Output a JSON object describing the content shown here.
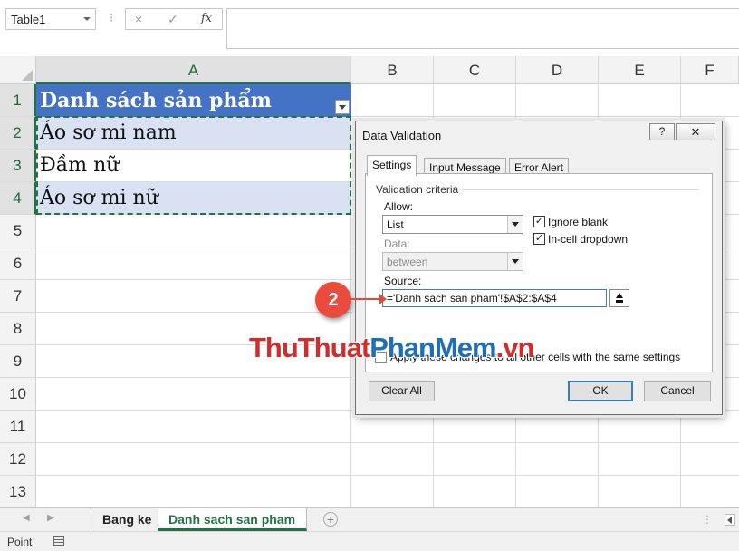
{
  "formula_bar": {
    "name_box": "Table1",
    "separator": "⁝",
    "cancel_icon": "×",
    "enter_icon": "✓",
    "fx_label": "fx",
    "formula": ""
  },
  "columns": [
    "A",
    "B",
    "C",
    "D",
    "E",
    "F"
  ],
  "rows": [
    "1",
    "2",
    "3",
    "4",
    "5",
    "6",
    "7",
    "8",
    "9",
    "10",
    "11",
    "12",
    "13"
  ],
  "cells": {
    "a1": "Danh sách sản phẩm",
    "a2": "Áo sơ mi nam",
    "a3": "Đầm nữ",
    "a4": "Áo sơ mi nữ"
  },
  "sheet_tabs": {
    "prev_icon": "◀",
    "next_icon": "▶",
    "tab1": "Bang ke",
    "tab2": "Danh sach san pham",
    "add_icon": "+",
    "dots": "⋮"
  },
  "status_bar": {
    "mode": "Point"
  },
  "dialog": {
    "title": "Data Validation",
    "help": "?",
    "close": "✕",
    "tabs": [
      "Settings",
      "Input Message",
      "Error Alert"
    ],
    "group": "Validation criteria",
    "allow_label": "Allow:",
    "allow_value": "List",
    "ignore_blank": "Ignore blank",
    "in_cell_dropdown": "In-cell dropdown",
    "checkmark": "✓",
    "data_label": "Data:",
    "data_value": "between",
    "source_label": "Source:",
    "source_value": "='Danh sach san pham'!$A$2:$A$4",
    "apply_all": "Apply these changes to all other cells with the same settings",
    "clear_all": "Clear All",
    "ok": "OK",
    "cancel": "Cancel"
  },
  "callout": {
    "number": "2"
  },
  "watermark": {
    "part1": "ThuThuat",
    "part2": "PhanMem",
    "part3": ".vn"
  }
}
